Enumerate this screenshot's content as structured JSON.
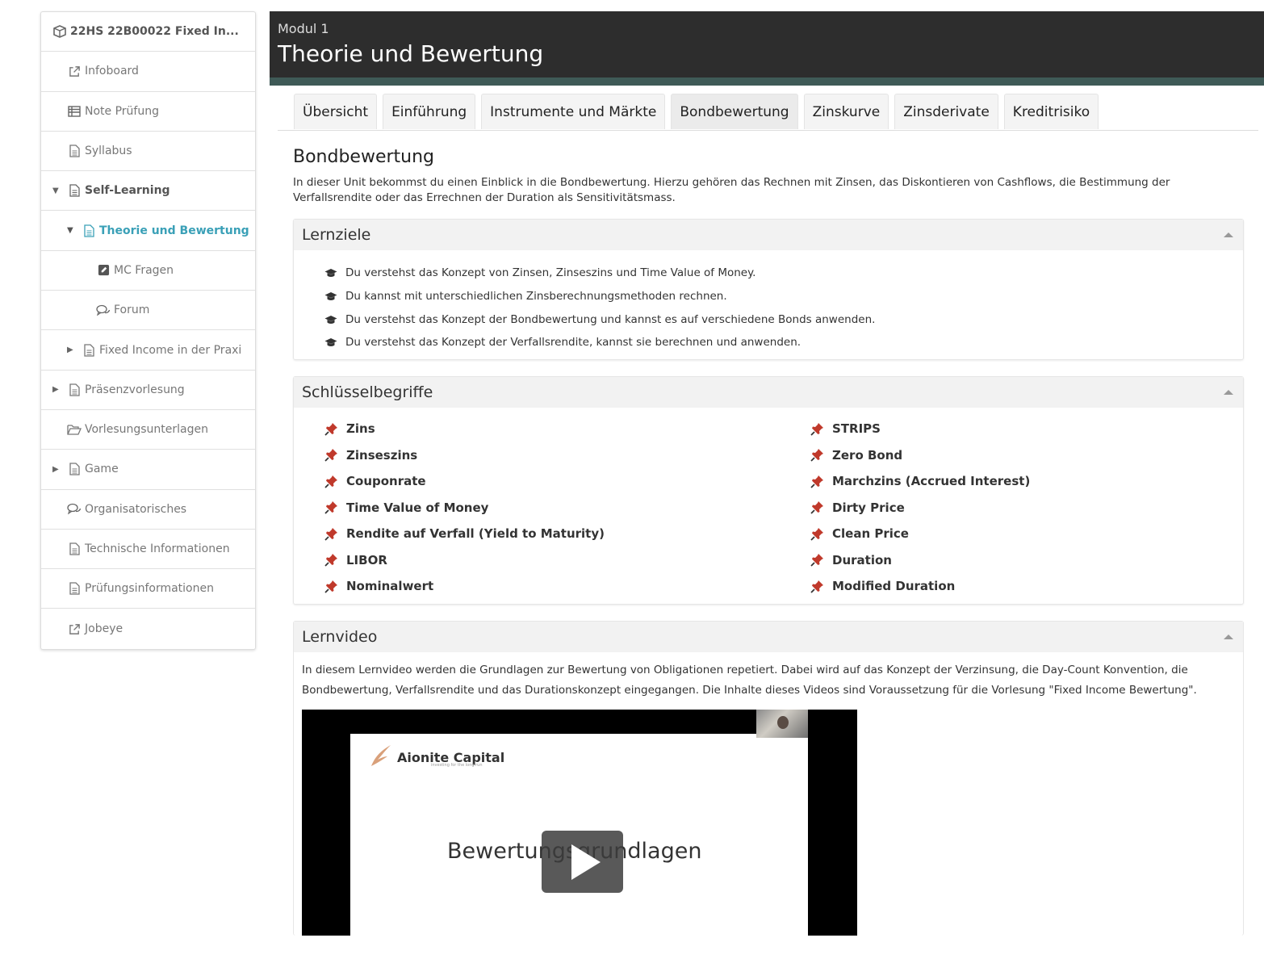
{
  "sidebar": {
    "items": [
      {
        "label": "22HS 22B00022 Fixed In...",
        "icon": "cube-icon"
      },
      {
        "label": "Infoboard",
        "icon": "external-link-icon"
      },
      {
        "label": "Note Prüfung",
        "icon": "list-icon"
      },
      {
        "label": "Syllabus",
        "icon": "document-icon"
      },
      {
        "label": "Self-Learning",
        "icon": "document-icon"
      },
      {
        "label": "Theorie und Bewertung",
        "icon": "document-icon"
      },
      {
        "label": "MC Fragen",
        "icon": "edit-icon"
      },
      {
        "label": "Forum",
        "icon": "comments-icon"
      },
      {
        "label": "Fixed Income in der Praxi",
        "icon": "document-icon"
      },
      {
        "label": "Präsenzvorlesung",
        "icon": "document-icon"
      },
      {
        "label": "Vorlesungsunterlagen",
        "icon": "folder-open-icon"
      },
      {
        "label": "Game",
        "icon": "document-icon"
      },
      {
        "label": "Organisatorisches",
        "icon": "comments-icon"
      },
      {
        "label": "Technische Informationen",
        "icon": "document-icon"
      },
      {
        "label": "Prüfungsinformationen",
        "icon": "document-icon"
      },
      {
        "label": "Jobeye",
        "icon": "external-link-icon"
      }
    ]
  },
  "header": {
    "subtitle": "Modul 1",
    "title": "Theorie und Bewertung"
  },
  "tabs": [
    {
      "label": "Übersicht"
    },
    {
      "label": "Einführung"
    },
    {
      "label": "Instrumente und Märkte"
    },
    {
      "label": "Bondbewertung"
    },
    {
      "label": "Zinskurve"
    },
    {
      "label": "Zinsderivate"
    },
    {
      "label": "Kreditrisiko"
    }
  ],
  "content": {
    "title": "Bondbewertung",
    "description": "In dieser Unit bekommst du einen Einblick in die Bondbewertung. Hierzu gehören das Rechnen mit Zinsen, das Diskontieren von Cashflows, die Bestimmung der Verfallsrendite oder das Errechnen der Duration als Sensitivitätsmass.",
    "lernziele": {
      "heading": "Lernziele",
      "items": [
        "Du verstehst das Konzept von Zinsen, Zinseszins und Time Value of Money.",
        "Du kannst mit unterschiedlichen Zinsberechnungsmethoden rechnen.",
        "Du verstehst das Konzept der Bondbewertung und kannst es auf verschiedene Bonds anwenden.",
        "Du verstehst das Konzept der Verfallsrendite, kannst sie berechnen und anwenden."
      ]
    },
    "schluesselbegriffe": {
      "heading": "Schlüsselbegriffe",
      "left": [
        "Zins",
        "Zinseszins",
        "Couponrate",
        "Time Value of Money",
        "Rendite auf Verfall (Yield to Maturity)",
        "LIBOR",
        "Nominalwert"
      ],
      "right": [
        "STRIPS",
        "Zero Bond",
        "Marchzins (Accrued Interest)",
        "Dirty Price",
        "Clean Price",
        "Duration",
        "Modified Duration"
      ]
    },
    "lernvideo": {
      "heading": "Lernvideo",
      "description": "In diesem Lernvideo werden die Grundlagen zur Bewertung von Obligationen repetiert. Dabei wird auf das Konzept der Verzinsung, die Day-Count Konvention, die Bondbewertung, Verfallsrendite und das Durationskonzept eingegangen. Die Inhalte dieses Videos sind Voraussetzung für die Vorlesung \"Fixed Income Bewertung\".",
      "slide_logo": "Aionite Capital",
      "slide_logo_sub": "investing for the long run",
      "slide_title": "Bewertungsgrundlagen"
    }
  },
  "colors": {
    "header_bg": "#2d2d2d",
    "header_accent": "#3f5a57",
    "active_link": "#3aa0b7",
    "pin": "#c0392b"
  }
}
